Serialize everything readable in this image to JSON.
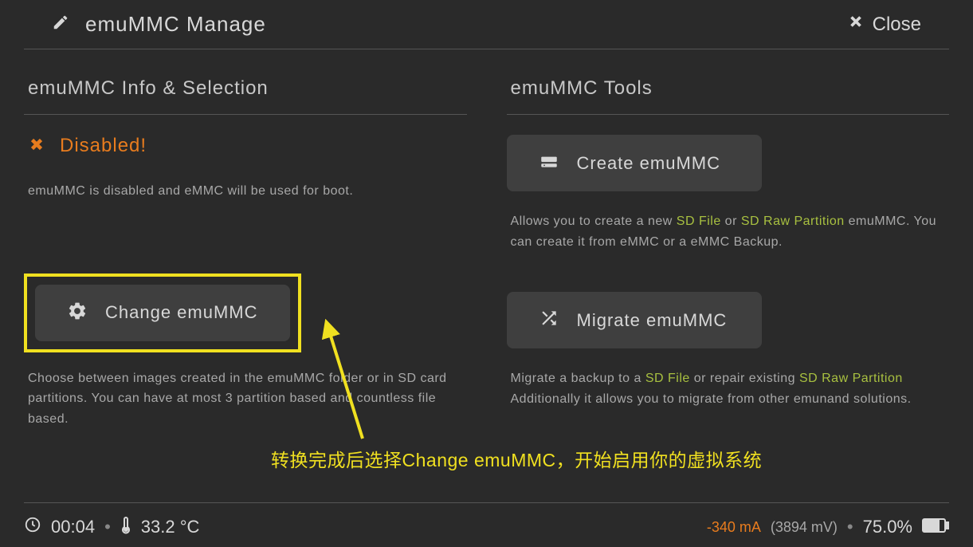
{
  "header": {
    "title": "emuMMC Manage",
    "close_label": "Close"
  },
  "info_section": {
    "title": "emuMMC Info & Selection",
    "status": "Disabled!",
    "status_desc": "emuMMC is disabled and eMMC will be used for boot.",
    "change_btn": "Change emuMMC",
    "change_desc_1": "Choose between images created in the emuMMC folder or in SD card partitions. You can have at most 3 partition based and countless file based."
  },
  "tools_section": {
    "title": "emuMMC Tools",
    "create_btn": "Create emuMMC",
    "create_desc_pre": "Allows you to create a new ",
    "create_link1": "SD File",
    "create_desc_mid": " or ",
    "create_link2": "SD Raw Partition",
    "create_desc_post": " emuMMC. You can create it from eMMC or a eMMC Backup.",
    "migrate_btn": "Migrate emuMMC",
    "migrate_desc_pre": "Migrate a backup to a ",
    "migrate_link1": "SD File",
    "migrate_desc_mid": " or repair existing ",
    "migrate_link2": "SD Raw Partition",
    "migrate_desc_post": " Additionally it allows you to migrate from other emunand solutions."
  },
  "annotation": "转换完成后选择Change emuMMC，开始启用你的虚拟系统",
  "footer": {
    "time": "00:04",
    "temp": "33.2 °C",
    "current": "-340 mA",
    "voltage": "(3894 mV)",
    "battery": "75.0%"
  }
}
